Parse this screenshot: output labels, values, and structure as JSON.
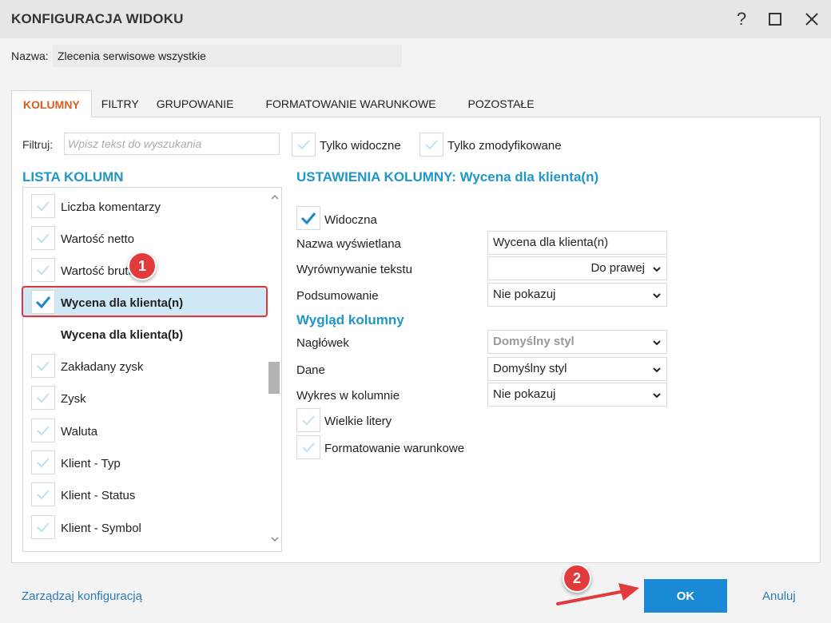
{
  "dialog": {
    "title": "KONFIGURACJA WIDOKU"
  },
  "name": {
    "label": "Nazwa:",
    "value": "Zlecenia serwisowe wszystkie"
  },
  "tabs": [
    {
      "label": "KOLUMNY",
      "active": true
    },
    {
      "label": "FILTRY",
      "active": false
    },
    {
      "label": "GRUPOWANIE",
      "active": false
    },
    {
      "label": "FORMATOWANIE WARUNKOWE",
      "active": false
    },
    {
      "label": "POZOSTAŁE",
      "active": false
    }
  ],
  "filter": {
    "label": "Filtruj:",
    "placeholder": "Wpisz tekst do wyszukania",
    "only_visible": "Tylko widoczne",
    "only_modified": "Tylko zmodyfikowane"
  },
  "column_list": {
    "title": "LISTA KOLUMN",
    "items": [
      {
        "label": "Liczba komentarzy",
        "checked": false
      },
      {
        "label": "Wartość netto",
        "checked": false
      },
      {
        "label": "Wartość brutto",
        "checked": false
      },
      {
        "label": "Wycena dla klienta(n)",
        "checked": true,
        "selected": true
      },
      {
        "label": "Wycena dla klienta(b)",
        "checked": false,
        "bold": true
      },
      {
        "label": "Zakładany zysk",
        "checked": false
      },
      {
        "label": "Zysk",
        "checked": false
      },
      {
        "label": "Waluta",
        "checked": false
      },
      {
        "label": "Klient - Typ",
        "checked": false
      },
      {
        "label": "Klient - Status",
        "checked": false
      },
      {
        "label": "Klient - Symbol",
        "checked": false
      }
    ]
  },
  "settings": {
    "title": "USTAWIENIA KOLUMNY: Wycena dla klienta(n)",
    "visible_label": "Widoczna",
    "display_name_label": "Nazwa wyświetlana",
    "display_name_value": "Wycena dla klienta(n)",
    "align_label": "Wyrównywanie tekstu",
    "align_value": "Do prawej",
    "summary_label": "Podsumowanie",
    "summary_value": "Nie pokazuj",
    "appearance_title": "Wygląd kolumny",
    "header_label": "Nagłówek",
    "header_value": "Domyślny styl",
    "data_label": "Dane",
    "data_value": "Domyślny styl",
    "chart_label": "Wykres w kolumnie",
    "chart_value": "Nie pokazuj",
    "uppercase_label": "Wielkie litery",
    "conditional_label": "Formatowanie warunkowe"
  },
  "annotations": {
    "badge1": "1",
    "badge2": "2"
  },
  "footer": {
    "manage_label": "Zarządzaj konfiguracją",
    "ok_label": "OK",
    "cancel_label": "Anuluj"
  },
  "colors": {
    "accent_blue": "#2196c9",
    "active_tab": "#e05a1c",
    "ok_button": "#1a8ad6",
    "annotation_red": "#e23b3b"
  }
}
